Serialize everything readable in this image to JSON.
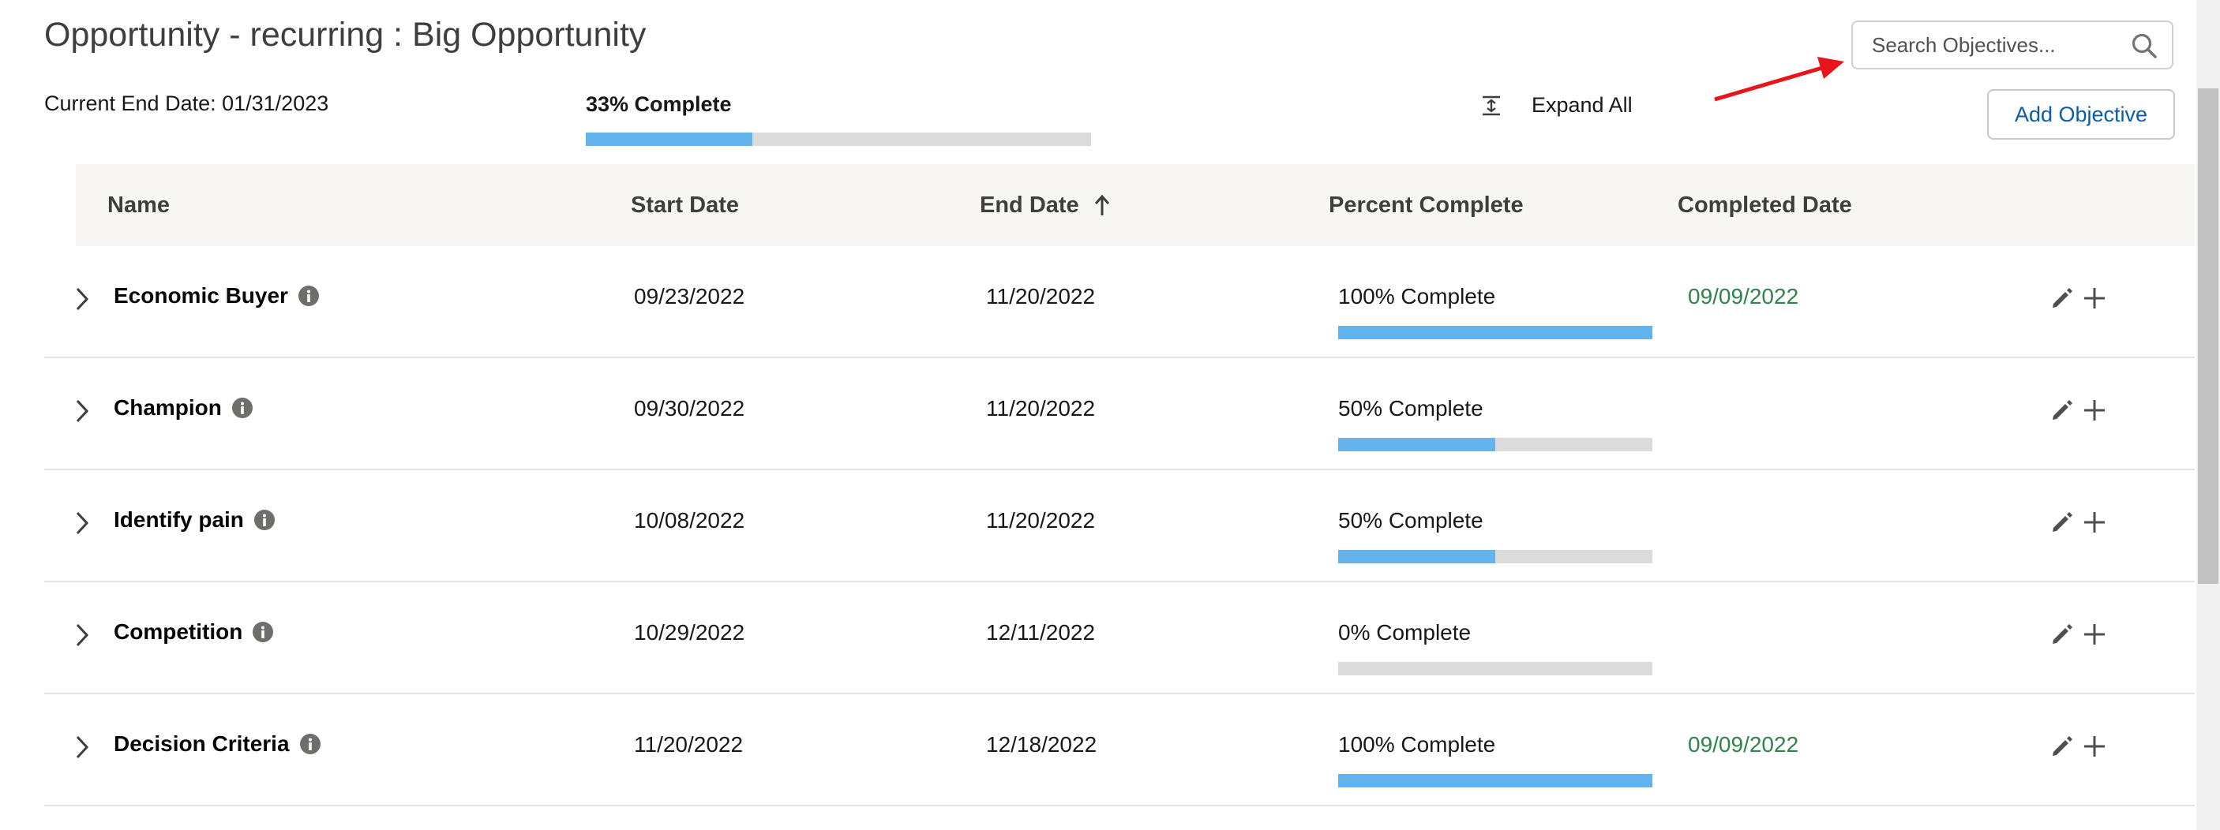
{
  "page": {
    "title": "Opportunity - recurring : Big Opportunity",
    "current_end_date": "Current End Date: 01/31/2023",
    "overall_progress_label": "33% Complete",
    "overall_progress_fraction": 0.33
  },
  "search": {
    "placeholder": "Search Objectives..."
  },
  "toolbar": {
    "expand_all_label": "Expand All",
    "add_objective_label": "Add Objective"
  },
  "table": {
    "columns": [
      "Name",
      "Start Date",
      "End Date",
      "Percent Complete",
      "Completed Date"
    ],
    "sorted_column": "End Date",
    "sort_direction": "ascending",
    "rows": [
      {
        "name": "Economic Buyer",
        "start_date": "09/23/2022",
        "end_date": "11/20/2022",
        "percent_label": "100% Complete",
        "percent": 100,
        "completed_date": "09/09/2022"
      },
      {
        "name": "Champion",
        "start_date": "09/30/2022",
        "end_date": "11/20/2022",
        "percent_label": "50% Complete",
        "percent": 50,
        "completed_date": ""
      },
      {
        "name": "Identify pain",
        "start_date": "10/08/2022",
        "end_date": "11/20/2022",
        "percent_label": "50% Complete",
        "percent": 50,
        "completed_date": ""
      },
      {
        "name": "Competition",
        "start_date": "10/29/2022",
        "end_date": "12/11/2022",
        "percent_label": "0% Complete",
        "percent": 0,
        "completed_date": ""
      },
      {
        "name": "Decision Criteria",
        "start_date": "11/20/2022",
        "end_date": "12/18/2022",
        "percent_label": "100% Complete",
        "percent": 100,
        "completed_date": "09/09/2022"
      }
    ]
  },
  "icons": {
    "search": "search-icon",
    "expand": "expand-all-icon",
    "sort": "arrow-up-icon",
    "row_toggle": "chevron-right-icon",
    "info": "info-icon",
    "edit": "pencil-icon",
    "add": "plus-icon",
    "annotation": "red-arrow-icon"
  },
  "colors": {
    "progress_fill": "#63b3ef",
    "progress_track": "#dddbda",
    "completed_date": "#2e844a",
    "button_text": "#0b5cab",
    "annotation_arrow": "#e8141b",
    "header_background": "#f7f6f4"
  }
}
